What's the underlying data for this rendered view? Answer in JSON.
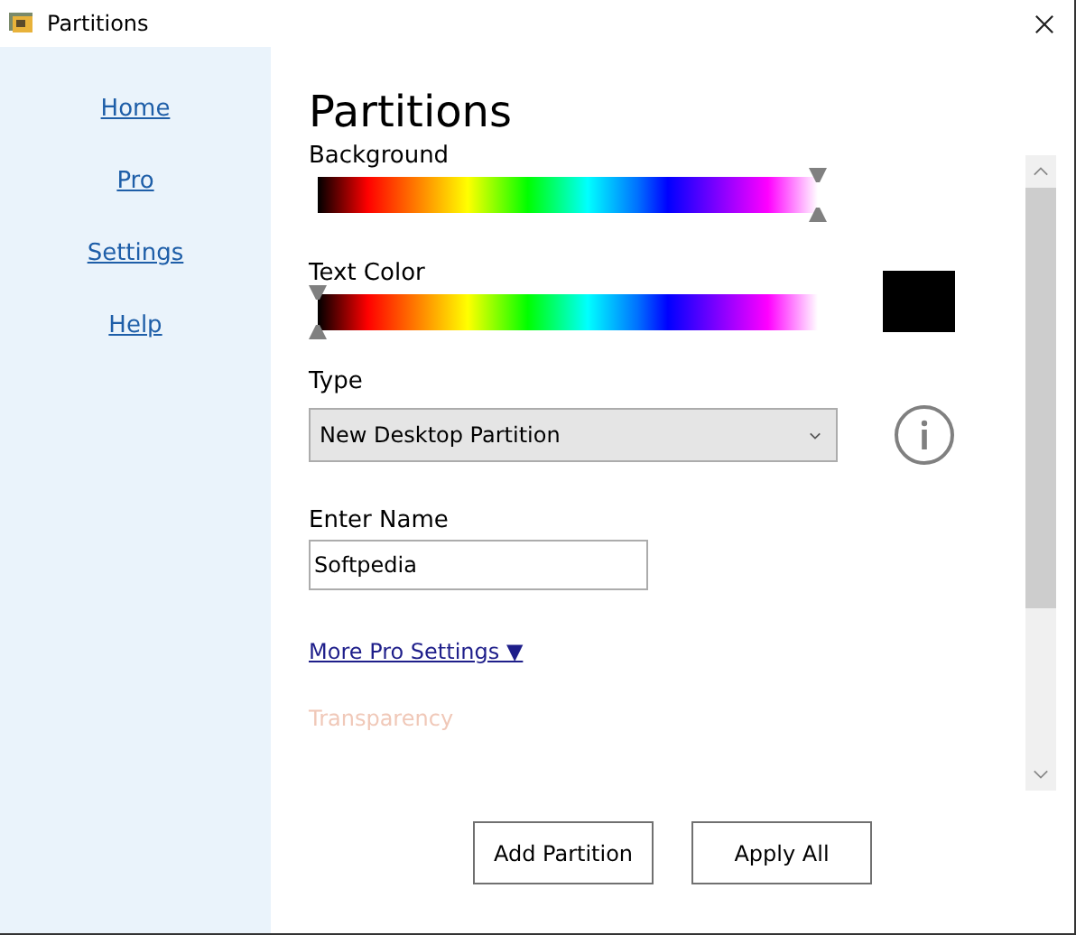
{
  "window": {
    "title": "Partitions"
  },
  "sidebar": {
    "items": [
      {
        "label": "Home"
      },
      {
        "label": "Pro"
      },
      {
        "label": "Settings"
      },
      {
        "label": "Help"
      }
    ]
  },
  "heading": "Partitions",
  "sliders": [
    {
      "kind": "plain",
      "label": "Background",
      "level": 1
    },
    {
      "kind": "swatch",
      "label": "Text Color",
      "level": 0
    }
  ],
  "type": {
    "label": "Type",
    "value": "New Desktop Partition"
  },
  "name": {
    "label": "Enter Name",
    "value": "Softpedia"
  },
  "more_link": "More Pro Settings ▼",
  "transparency_label": "Transparency",
  "buttons": [
    "Add Partition",
    "Apply All"
  ]
}
